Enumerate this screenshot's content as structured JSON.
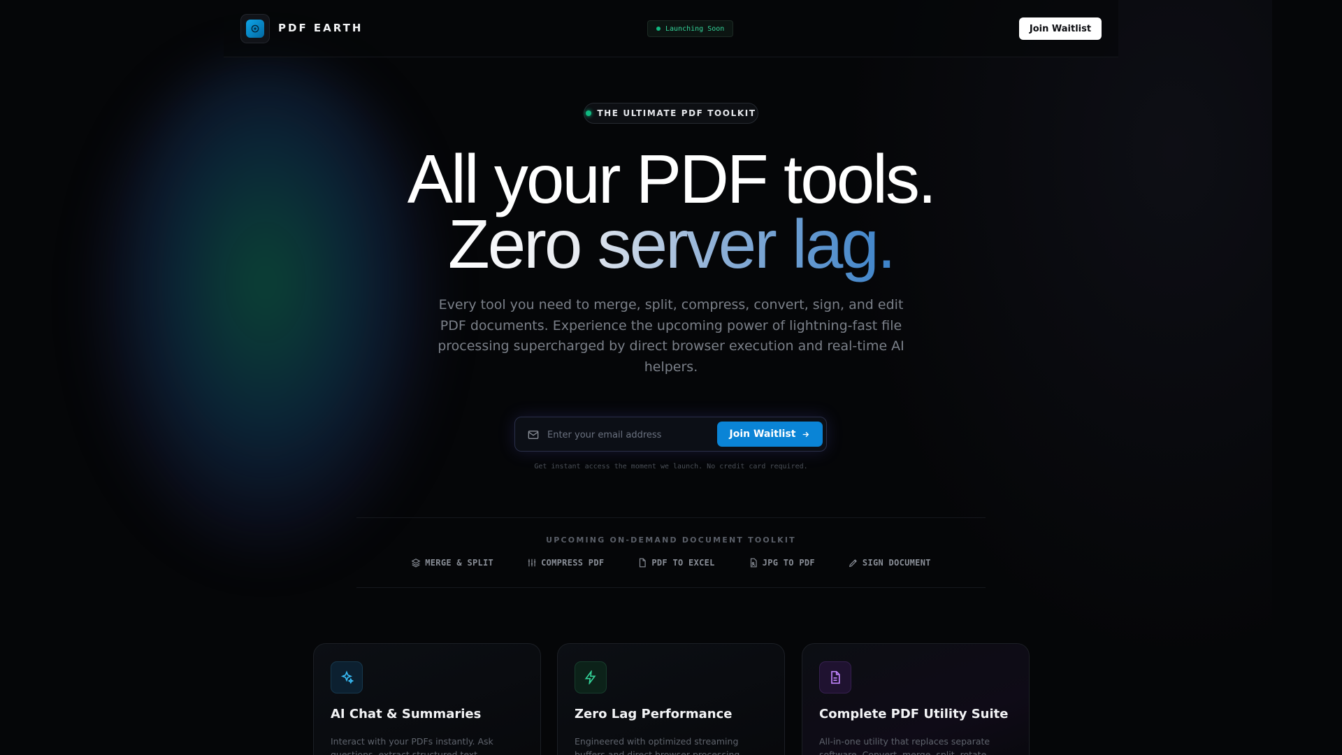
{
  "header": {
    "brand": "PDF EARTH",
    "badge": "Launching Soon",
    "join_label": "Join Waitlist"
  },
  "hero": {
    "eyebrow": "THE ULTIMATE PDF TOOLKIT",
    "title_line1": "All your PDF tools.",
    "title_line2": "Zero server lag.",
    "subtitle": "Every tool you need to merge, split, compress, convert, sign, and edit PDF documents. Experience the upcoming power of lightning-fast file processing supercharged by direct browser execution and real-time AI helpers."
  },
  "signup": {
    "email_placeholder": "Enter your email address",
    "email_value": "",
    "button_label": "Join Waitlist",
    "fine_print": "Get instant access the moment we launch. No credit card required."
  },
  "toolkit": {
    "title": "UPCOMING ON-DEMAND DOCUMENT TOOLKIT",
    "items": [
      {
        "label": "MERGE & SPLIT",
        "icon": "layers-icon"
      },
      {
        "label": "COMPRESS PDF",
        "icon": "sliders-icon"
      },
      {
        "label": "PDF TO EXCEL",
        "icon": "file-icon"
      },
      {
        "label": "JPG TO PDF",
        "icon": "file-image-icon"
      },
      {
        "label": "SIGN DOCUMENT",
        "icon": "pen-icon"
      }
    ]
  },
  "features": [
    {
      "title": "AI Chat & Summaries",
      "desc": "Interact with your PDFs instantly. Ask questions, extract structured text",
      "icon": "sparkles-icon",
      "accent": "#38bdf8"
    },
    {
      "title": "Zero Lag Performance",
      "desc": "Engineered with optimized streaming buffers and direct browser processing pipelines. No",
      "icon": "zap-icon",
      "accent": "#34d399"
    },
    {
      "title": "Complete PDF Utility Suite",
      "desc": "All-in-one utility that replaces separate software. Convert, merge, split, rotate",
      "icon": "document-icon",
      "accent": "#c084fc"
    }
  ],
  "colors": {
    "background": "#050608",
    "primary": "#0a84d6",
    "accent_green": "#10b981"
  }
}
